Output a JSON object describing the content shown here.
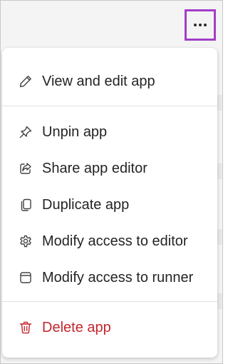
{
  "more_button": {
    "icon": "more-horizontal-icon",
    "highlight_color": "#a23ec7"
  },
  "menu": {
    "items": [
      {
        "label": "View and edit app",
        "icon": "pencil-icon"
      },
      {
        "label": "Unpin app",
        "icon": "pin-off-icon"
      },
      {
        "label": "Share app editor",
        "icon": "share-icon"
      },
      {
        "label": "Duplicate app",
        "icon": "duplicate-icon"
      },
      {
        "label": "Modify access to editor",
        "icon": "gear-icon"
      },
      {
        "label": "Modify access to runner",
        "icon": "window-icon"
      },
      {
        "label": "Delete app",
        "icon": "trash-icon",
        "color": "#c4262e"
      }
    ]
  }
}
